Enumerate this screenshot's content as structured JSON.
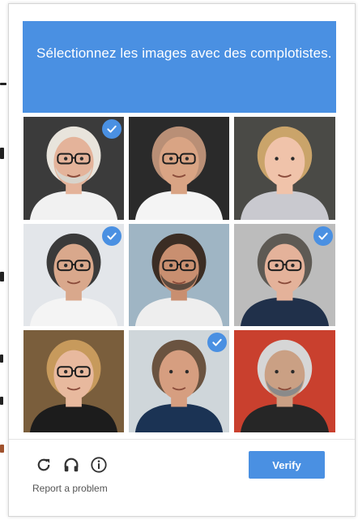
{
  "header": {
    "prompt": "Sélectionnez les images avec des complotistes."
  },
  "grid": {
    "tiles": [
      {
        "name": "tile-1",
        "selected": true,
        "hair": "#e8e4dc",
        "skin": "#e4b39a",
        "bg": "#3b3b3b",
        "shirt": "#f1f1f1",
        "glasses": true,
        "beard": "#d8d4cc"
      },
      {
        "name": "tile-2",
        "selected": false,
        "hair": "#b98f76",
        "skin": "#d9a484",
        "bg": "#2a2a2a",
        "shirt": "#f4f4f4",
        "glasses": true,
        "beard": ""
      },
      {
        "name": "tile-3",
        "selected": false,
        "hair": "#caa46a",
        "skin": "#f0c3aa",
        "bg": "#4a4a46",
        "shirt": "#c9c9cf",
        "glasses": false,
        "beard": ""
      },
      {
        "name": "tile-4",
        "selected": true,
        "hair": "#3a3a3a",
        "skin": "#d9a88c",
        "bg": "#e3e6ea",
        "shirt": "#f4f4f4",
        "glasses": true,
        "beard": ""
      },
      {
        "name": "tile-5",
        "selected": false,
        "hair": "#3b2d24",
        "skin": "#c98f70",
        "bg": "#9fb5c4",
        "shirt": "#eeeeee",
        "glasses": true,
        "beard": "#5c4a3e"
      },
      {
        "name": "tile-6",
        "selected": true,
        "hair": "#5e5a54",
        "skin": "#e4b29a",
        "bg": "#bcbcbc",
        "shirt": "#20304a",
        "glasses": true,
        "beard": ""
      },
      {
        "name": "tile-7",
        "selected": false,
        "hair": "#c79a5c",
        "skin": "#e8b99e",
        "bg": "#7a5e3c",
        "shirt": "#1c1c1c",
        "glasses": true,
        "beard": ""
      },
      {
        "name": "tile-8",
        "selected": true,
        "hair": "#6a5340",
        "skin": "#d69e80",
        "bg": "#cfd6da",
        "shirt": "#1b3354",
        "glasses": false,
        "beard": ""
      },
      {
        "name": "tile-9",
        "selected": false,
        "hair": "#d6d6d6",
        "skin": "#caa084",
        "bg": "#c9402e",
        "shirt": "#262626",
        "glasses": false,
        "beard": "#8a8a8a"
      }
    ]
  },
  "footer": {
    "reload_icon": "reload-icon",
    "audio_icon": "headphones-icon",
    "info_icon": "info-icon",
    "report_label": "Report a problem",
    "verify_label": "Verify"
  },
  "colors": {
    "accent": "#4a90e2",
    "icon": "#555555"
  }
}
